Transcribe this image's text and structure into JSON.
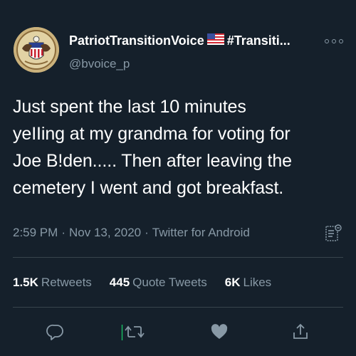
{
  "user": {
    "display_name": "PatriotTransitionVoice",
    "flag_icon": "us-flag-icon",
    "hashtag": "#Transiti...",
    "handle": "@bvoice_p",
    "avatar_icon": "eagle-seal-avatar"
  },
  "tweet": {
    "lines": [
      "Just spent the last 10 minutes",
      "yeIIing at my grandma for voting for",
      "Joe B!den..... Then after leaving the",
      "cemetery I went and got breakfast."
    ]
  },
  "meta": {
    "time": "2:59 PM",
    "date": "Nov 13, 2020",
    "source": "Twitter for Android",
    "separator": "·"
  },
  "stats": {
    "retweets_count": "1.5K",
    "retweets_label": "Retweets",
    "quotes_count": "445",
    "quotes_label": "Quote Tweets",
    "likes_count": "6K",
    "likes_label": "Likes"
  },
  "colors": {
    "background": "#15202b",
    "text": "#ffffff",
    "secondary": "#8899a6",
    "divider": "#38444d"
  },
  "icons": [
    "more-icon",
    "tweet-analytics-icon",
    "reply-icon",
    "retweet-icon",
    "like-icon",
    "share-icon"
  ]
}
